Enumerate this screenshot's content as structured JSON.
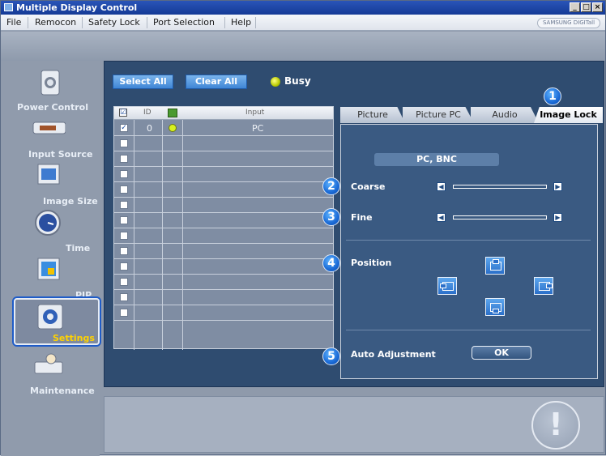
{
  "window": {
    "title": "Multiple Display Control"
  },
  "menu": {
    "items": [
      "File",
      "Remocon",
      "Safety Lock",
      "Port Selection",
      "Help"
    ],
    "brand": "SAMSUNG DIGITall"
  },
  "sidebar": {
    "items": [
      {
        "label": "Power Control",
        "icon": "power-icon"
      },
      {
        "label": "Input Source",
        "icon": "input-source-icon"
      },
      {
        "label": "Image Size",
        "icon": "image-size-icon"
      },
      {
        "label": "Time",
        "icon": "clock-icon"
      },
      {
        "label": "PIP",
        "icon": "pip-icon"
      },
      {
        "label": "Settings",
        "icon": "settings-icon",
        "active": true
      },
      {
        "label": "Maintenance",
        "icon": "maintenance-icon"
      }
    ]
  },
  "toolbar": {
    "select_all": "Select All",
    "clear_all": "Clear All",
    "status": "Busy"
  },
  "grid": {
    "headers": {
      "check": "☑",
      "id": "ID",
      "status": "",
      "input": "Input"
    },
    "rows": [
      {
        "checked": true,
        "id": "0",
        "input": "PC"
      }
    ],
    "empty_rows": 12
  },
  "tabs": [
    "Picture",
    "Picture PC",
    "Audio",
    "Image Lock"
  ],
  "image_lock": {
    "source": "PC, BNC",
    "coarse_label": "Coarse",
    "fine_label": "Fine",
    "position_label": "Position",
    "auto_label": "Auto Adjustment",
    "ok_label": "OK",
    "badges": [
      "1",
      "2",
      "3",
      "4",
      "5"
    ]
  },
  "colors": {
    "accent": "#1a6ad6",
    "panel": "#2f4c70",
    "active_label": "#ffd200"
  }
}
